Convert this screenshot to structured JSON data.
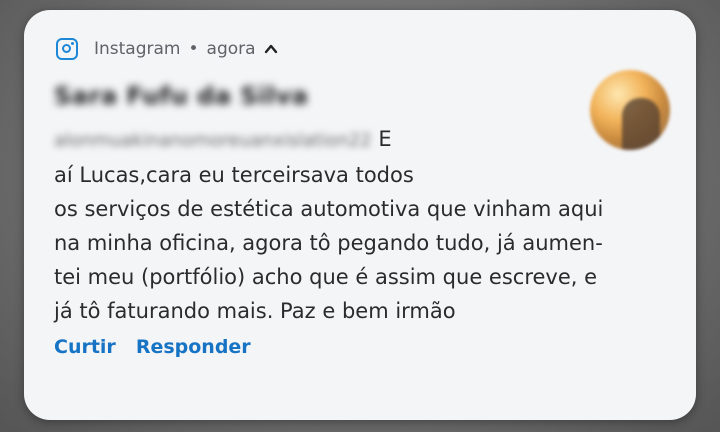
{
  "notification": {
    "app_icon": "instagram-icon",
    "app_name": "Instagram",
    "separator": "•",
    "time": "agora",
    "collapse_icon": "chevron-up-icon",
    "sender_name": "Sara Fufu da Silva",
    "sender_username": "alonmuakinanomoreuanxislation22",
    "message_lines": [
      "E",
      "aí Lucas,cara eu terceirsava todos",
      "os serviços de estética automotiva que vinham aqui",
      "na minha oficina, agora tô pegando tudo, já aumen-",
      "tei meu (portfólio) acho que é assim que escreve, e",
      "já tô faturando mais. Paz e bem irmão"
    ],
    "actions": {
      "like": "Curtir",
      "reply": "Responder"
    },
    "colors": {
      "accent": "#1773c4",
      "icon": "#1e88d8",
      "card_bg": "#f4f5f7"
    }
  }
}
